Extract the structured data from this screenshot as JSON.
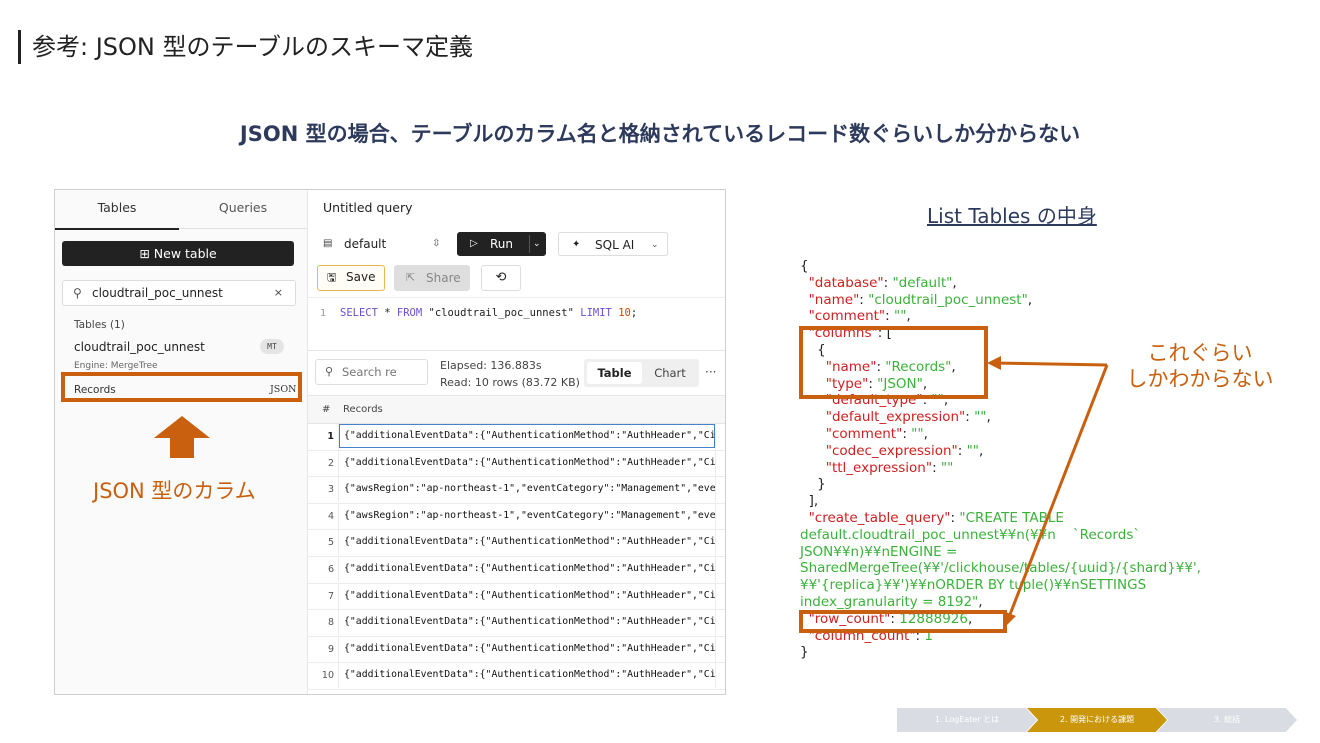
{
  "slide": {
    "title": "参考: JSON 型のテーブルのスキーマ定義",
    "subtitle": "JSON 型の場合、テーブルのカラム名と格納されているレコード数ぐらいしか分からない"
  },
  "sidebar": {
    "tabs": [
      "Tables",
      "Queries"
    ],
    "new_table_label": "New table",
    "new_table_icon": "⊞",
    "search_value": "cloudtrail_poc_unnest",
    "tables_heading": "Tables (1)",
    "table_name": "cloudtrail_poc_unnest",
    "table_badge": "MT",
    "table_engine": "Engine: MergeTree",
    "column_name": "Records",
    "column_type": "JSON"
  },
  "editor": {
    "query_title": "Untitled query",
    "database": "default",
    "run_label": "Run",
    "sql_ai_label": "SQL AI",
    "save_label": "Save",
    "share_label": "Share",
    "line_number": "1",
    "sql": {
      "kw1": "SELECT",
      "star": " * ",
      "kw2": "FROM",
      "table": " \"cloudtrail_poc_unnest\" ",
      "kw3": "LIMIT",
      "limit": "10",
      "end": ";"
    }
  },
  "results": {
    "search_placeholder": "Search re",
    "elapsed": "Elapsed: 136.883s",
    "read": "Read: 10 rows (83.72 KB)",
    "view_table": "Table",
    "view_chart": "Chart",
    "more": "···",
    "header_hash": "#",
    "header_column": "Records",
    "rows": [
      {
        "n": "1",
        "v": "{\"additionalEventData\":{\"AuthenticationMethod\":\"AuthHeader\",\"Ci…"
      },
      {
        "n": "2",
        "v": "{\"additionalEventData\":{\"AuthenticationMethod\":\"AuthHeader\",\"Ci…"
      },
      {
        "n": "3",
        "v": "{\"awsRegion\":\"ap-northeast-1\",\"eventCategory\":\"Management\",\"eve…"
      },
      {
        "n": "4",
        "v": "{\"awsRegion\":\"ap-northeast-1\",\"eventCategory\":\"Management\",\"eve…"
      },
      {
        "n": "5",
        "v": "{\"additionalEventData\":{\"AuthenticationMethod\":\"AuthHeader\",\"Ci…"
      },
      {
        "n": "6",
        "v": "{\"additionalEventData\":{\"AuthenticationMethod\":\"AuthHeader\",\"Ci…"
      },
      {
        "n": "7",
        "v": "{\"additionalEventData\":{\"AuthenticationMethod\":\"AuthHeader\",\"Ci…"
      },
      {
        "n": "8",
        "v": "{\"additionalEventData\":{\"AuthenticationMethod\":\"AuthHeader\",\"Ci…"
      },
      {
        "n": "9",
        "v": "{\"additionalEventData\":{\"AuthenticationMethod\":\"AuthHeader\",\"Ci…"
      },
      {
        "n": "10",
        "v": "{\"additionalEventData\":{\"AuthenticationMethod\":\"AuthHeader\",\"Ci…"
      }
    ]
  },
  "annotations": {
    "json_column_label": "JSON 型のカラム",
    "note_line1": "これぐらい",
    "note_line2": "しかわからない",
    "accent_color": "#c8600f"
  },
  "list_tables": {
    "title": "List Tables の中身",
    "lines": [
      [
        {
          "t": "{",
          "c": "brk"
        }
      ],
      [
        {
          "t": "  \"database\"",
          "c": "key"
        },
        {
          "t": ": ",
          "c": "brk"
        },
        {
          "t": "\"default\"",
          "c": "val"
        },
        {
          "t": ",",
          "c": "brk"
        }
      ],
      [
        {
          "t": "  \"name\"",
          "c": "key"
        },
        {
          "t": ": ",
          "c": "brk"
        },
        {
          "t": "\"cloudtrail_poc_unnest\"",
          "c": "val"
        },
        {
          "t": ",",
          "c": "brk"
        }
      ],
      [
        {
          "t": "  \"comment\"",
          "c": "key"
        },
        {
          "t": ": ",
          "c": "brk"
        },
        {
          "t": "\"\"",
          "c": "val"
        },
        {
          "t": ",",
          "c": "brk"
        }
      ],
      [
        {
          "t": "  \"columns\"",
          "c": "key"
        },
        {
          "t": ": [",
          "c": "brk"
        }
      ],
      [
        {
          "t": "    {",
          "c": "brk"
        }
      ],
      [
        {
          "t": "      \"name\"",
          "c": "key"
        },
        {
          "t": ": ",
          "c": "brk"
        },
        {
          "t": "\"Records\"",
          "c": "val"
        },
        {
          "t": ",",
          "c": "brk"
        }
      ],
      [
        {
          "t": "      \"type\"",
          "c": "key"
        },
        {
          "t": ": ",
          "c": "brk"
        },
        {
          "t": "\"JSON\"",
          "c": "val"
        },
        {
          "t": ",",
          "c": "brk"
        }
      ],
      [
        {
          "t": "      \"default_type\"",
          "c": "key"
        },
        {
          "t": ": ",
          "c": "brk"
        },
        {
          "t": "\"\"",
          "c": "val"
        },
        {
          "t": ",",
          "c": "brk"
        }
      ],
      [
        {
          "t": "      \"default_expression\"",
          "c": "key"
        },
        {
          "t": ": ",
          "c": "brk"
        },
        {
          "t": "\"\"",
          "c": "val"
        },
        {
          "t": ",",
          "c": "brk"
        }
      ],
      [
        {
          "t": "      \"comment\"",
          "c": "key"
        },
        {
          "t": ": ",
          "c": "brk"
        },
        {
          "t": "\"\"",
          "c": "val"
        },
        {
          "t": ",",
          "c": "brk"
        }
      ],
      [
        {
          "t": "      \"codec_expression\"",
          "c": "key"
        },
        {
          "t": ": ",
          "c": "brk"
        },
        {
          "t": "\"\"",
          "c": "val"
        },
        {
          "t": ",",
          "c": "brk"
        }
      ],
      [
        {
          "t": "      \"ttl_expression\"",
          "c": "key"
        },
        {
          "t": ": ",
          "c": "brk"
        },
        {
          "t": "\"\"",
          "c": "val"
        }
      ],
      [
        {
          "t": "    }",
          "c": "brk"
        }
      ],
      [
        {
          "t": "  ],",
          "c": "brk"
        }
      ],
      [
        {
          "t": "  \"create_table_query\"",
          "c": "key"
        },
        {
          "t": ": ",
          "c": "brk"
        },
        {
          "t": "\"CREATE TABLE",
          "c": "val"
        }
      ],
      [
        {
          "t": "default.cloudtrail_poc_unnest¥¥n(¥¥n    `Records`",
          "c": "val"
        }
      ],
      [
        {
          "t": "JSON¥¥n)¥¥nENGINE =",
          "c": "val"
        }
      ],
      [
        {
          "t": "SharedMergeTree(¥¥'/clickhouse/tables/{uuid}/{shard}¥¥',",
          "c": "val"
        }
      ],
      [
        {
          "t": "¥¥'{replica}¥¥')¥¥nORDER BY tuple()¥¥nSETTINGS",
          "c": "val"
        }
      ],
      [
        {
          "t": "index_granularity = 8192\"",
          "c": "val"
        },
        {
          "t": ",",
          "c": "brk"
        }
      ],
      [
        {
          "t": "  \"row_count\"",
          "c": "key"
        },
        {
          "t": ": ",
          "c": "brk"
        },
        {
          "t": "12888926",
          "c": "val"
        },
        {
          "t": ",",
          "c": "brk"
        }
      ],
      [
        {
          "t": "  \"column_count\"",
          "c": "key"
        },
        {
          "t": ": ",
          "c": "brk"
        },
        {
          "t": "1",
          "c": "val"
        }
      ],
      [
        {
          "t": "}",
          "c": "brk"
        }
      ]
    ]
  },
  "progress": {
    "steps": [
      {
        "label": "1. LogEater とは",
        "color": "#d9dde3",
        "active": false
      },
      {
        "label": "2. 開発における課題",
        "color": "#c9960c",
        "active": true
      },
      {
        "label": "3. 総括",
        "color": "#d9dde3",
        "active": false
      }
    ]
  }
}
